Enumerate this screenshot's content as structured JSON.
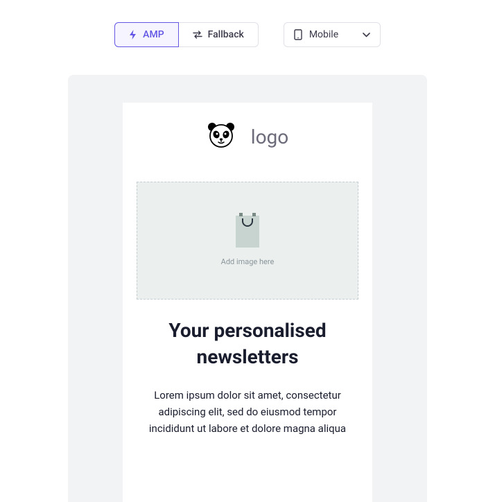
{
  "toolbar": {
    "tabs": {
      "amp": "AMP",
      "fallback": "Fallback"
    },
    "device": {
      "selected": "Mobile"
    }
  },
  "email": {
    "logo_text": "logo",
    "image_placeholder": "Add image here",
    "headline": "Your personalised newsletters",
    "body": "Lorem ipsum dolor sit amet, consectetur adipiscing elit, sed do eiusmod tempor incididunt ut labore et dolore magna aliqua"
  }
}
